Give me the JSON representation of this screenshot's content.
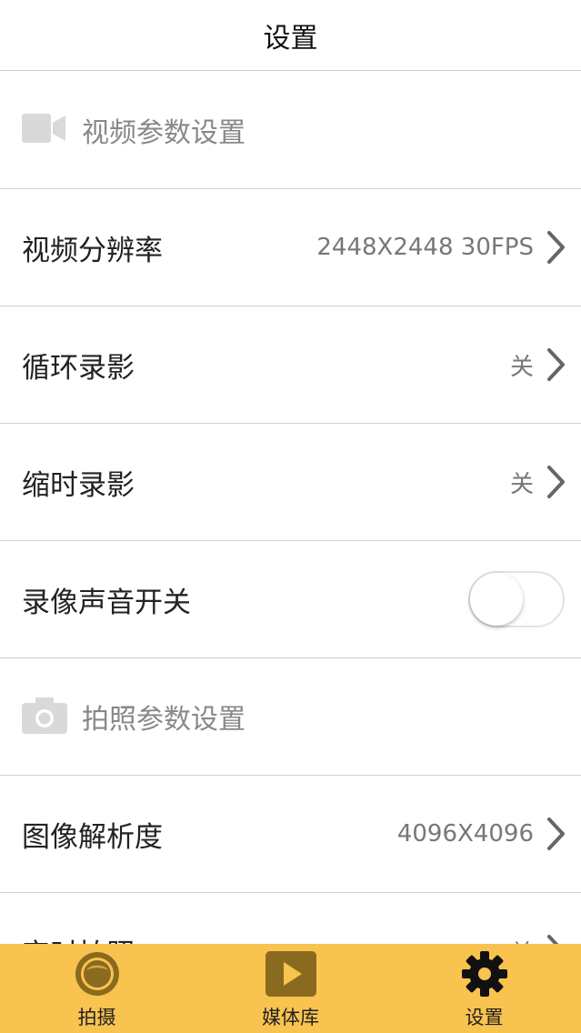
{
  "header": {
    "title": "设置"
  },
  "list": {
    "video_section": {
      "icon": "video-camera-icon",
      "label": "视频参数设置"
    },
    "video_resolution": {
      "label": "视频分辨率",
      "value": "2448X2448 30FPS"
    },
    "loop_recording": {
      "label": "循环录影",
      "value": "关"
    },
    "timelapse_recording": {
      "label": "缩时录影",
      "value": "关"
    },
    "record_audio": {
      "label": "录像声音开关",
      "toggle_on": false
    },
    "photo_section": {
      "icon": "camera-icon",
      "label": "拍照参数设置"
    },
    "image_resolution": {
      "label": "图像解析度",
      "value": "4096X4096"
    },
    "timed_photo": {
      "label": "定时拍照",
      "value": "关"
    }
  },
  "tabbar": {
    "tabs": [
      {
        "icon": "lens-icon",
        "label": "拍摄"
      },
      {
        "icon": "play-icon",
        "label": "媒体库"
      },
      {
        "icon": "gear-icon",
        "label": "设置",
        "active": true
      }
    ]
  },
  "colors": {
    "tabbar_bg": "#f9c34f",
    "tab_icon": "#8a6a1e",
    "divider": "#cfcfcf",
    "section_icon": "#d9d9d9"
  }
}
